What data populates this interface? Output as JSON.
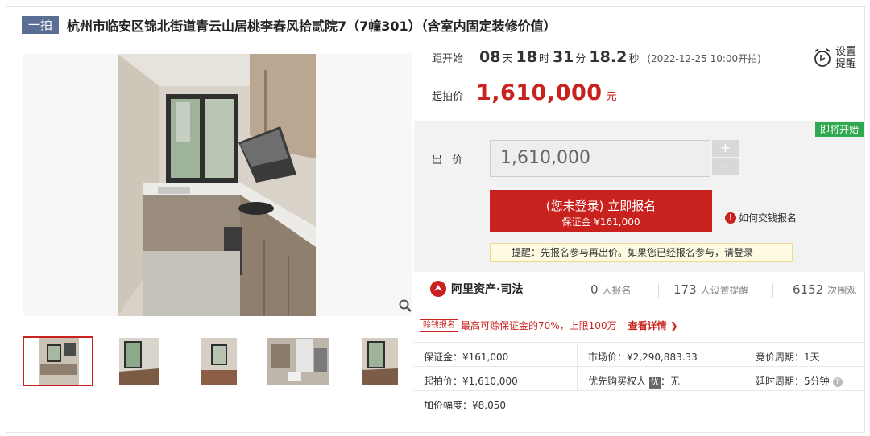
{
  "header": {
    "tag": "一拍",
    "title": "杭州市临安区锦北街道青云山居桃李春风拾贰院7（7幢301）（含室内固定装修价值）"
  },
  "countdown": {
    "label": "距开始",
    "days": "08",
    "days_unit": "天",
    "hours": "18",
    "hours_unit": "时",
    "minutes": "31",
    "minutes_unit": "分",
    "seconds": "18.2",
    "seconds_unit": "秒",
    "start_text": "(2022-12-25 10:00开拍)"
  },
  "reminder": {
    "line1": "设置",
    "line2": "提醒",
    "icon": "alarm-clock-icon"
  },
  "start_price": {
    "label": "起拍价",
    "value": "1,610,000",
    "unit": "元"
  },
  "bid": {
    "status_badge": "即将开始",
    "label": "出 价",
    "input_value": "1,610,000",
    "plus": "+",
    "minus": "-",
    "signup_main": "(您未登录) 立即报名",
    "signup_sub": "保证金 ¥161,000",
    "howto": "如何交钱报名",
    "tip_text": "提醒：先报名参与再出价。如果您已经报名参与，请",
    "tip_link": "登录"
  },
  "stats": {
    "brand": "阿里资产·司法",
    "signups_num": "0",
    "signups_label": "人报名",
    "reminders_num": "173",
    "reminders_label": "人设置提醒",
    "views_num": "6152",
    "views_label": "次围观"
  },
  "deduct": {
    "badge": "赊钱报名",
    "text": "最高可赊保证金的70%，上限100万",
    "link": "查看详情 ❯"
  },
  "details": {
    "deposit": "保证金：¥161,000",
    "market_price": "市场价：¥2,290,883.33",
    "auction_period": "竞价周期：1天",
    "start_price": "起拍价：¥1,610,000",
    "priority_prefix": "优先购买权人",
    "priority_badge": "优",
    "priority_suffix": "：无",
    "delay_period": "延时周期：5分钟",
    "increment": "加价幅度：¥8,050"
  },
  "colors": {
    "accent_red": "#c9211e",
    "tag_blue": "#5a6e93",
    "badge_green": "#2fa84f"
  }
}
